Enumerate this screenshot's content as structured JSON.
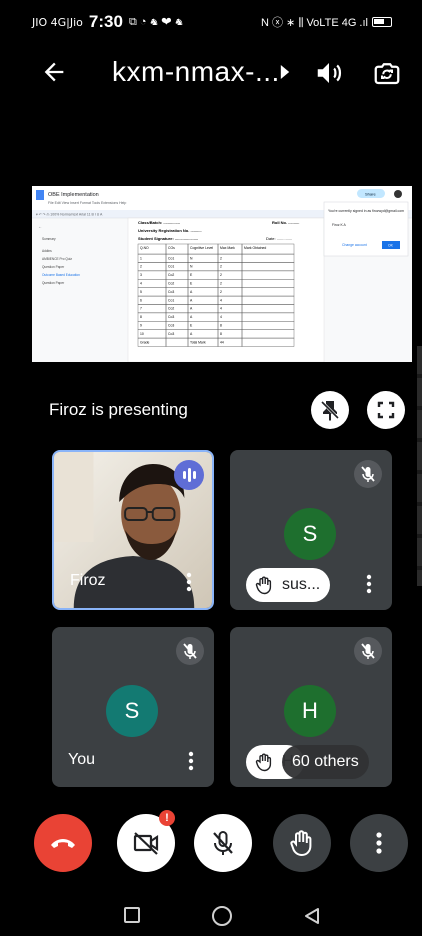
{
  "status_bar": {
    "carrier": "JIO 4G|Jio",
    "time": "7:30",
    "status_icons": "⧉ ◔ ♞ ❤ ♞",
    "network": "N ⓧ ∗ ⫼ VoLTE 4G .ıl"
  },
  "topbar": {
    "meeting_code": "kxm-nmax-...",
    "back_icon": "arrow-left-icon",
    "audio_icon": "volume-icon",
    "switch_icon": "switch-camera-icon"
  },
  "presentation": {
    "label": "Firoz is presenting",
    "doc": {
      "title": "OBE Implementation",
      "menu": "File  Edit  View  Insert  Format  Tools  Extensions  Help",
      "outline": [
        "Outline",
        "Summary",
        "Addins",
        "AMBIENCE Pro Quiz",
        "Question Paper",
        "Outcome Based Education",
        "Question Paper"
      ],
      "class_batch": "Class/Batch: ...............",
      "roll_no": "Roll  No. ..........",
      "reg_no": "University Registration No. ..........",
      "signature": "Student Signature: .....................",
      "date": "Date: ..............",
      "table_headers": [
        "Q.NO",
        "COs",
        "Cognitive Level",
        "Max Mark",
        "Mark Obtained"
      ],
      "rows": [
        [
          "1",
          "Co1",
          "N",
          "2"
        ],
        [
          "2",
          "Co1",
          "N",
          "2"
        ],
        [
          "3",
          "Co2",
          "E",
          "2"
        ],
        [
          "4",
          "Co2",
          "E",
          "2"
        ],
        [
          "5",
          "Co3",
          "A",
          "2"
        ],
        [
          "6",
          "Co1",
          "A",
          "4"
        ],
        [
          "7",
          "Co2",
          "A",
          "4"
        ],
        [
          "8",
          "Co3",
          "A",
          "4"
        ],
        [
          "9",
          "Co3",
          "E",
          "8"
        ],
        [
          "10",
          "Co3",
          "A",
          "8"
        ],
        [
          "Grade",
          "",
          "Total Mark",
          "44"
        ]
      ],
      "popup_text": "You're currently signed in as firozwyd@gmail.com",
      "popup_user": "Firoz K A",
      "popup_link": "Change account",
      "popup_ok": "OK",
      "share": "Share"
    }
  },
  "tiles": [
    {
      "name": "Firoz",
      "speaking": true
    },
    {
      "avatar": "S",
      "label": "sus...",
      "hand_raised": true
    },
    {
      "avatar": "S",
      "name": "You"
    },
    {
      "avatar": "H",
      "label": "H",
      "hand_raised": true
    }
  ],
  "others_chip": "60 others",
  "controls": {
    "cam_badge": "!"
  },
  "colors": {
    "end_call": "#e94335",
    "speaking": "#5f6dd6",
    "avatar": "#1e6f2e",
    "tile_bg": "#3c4043"
  }
}
